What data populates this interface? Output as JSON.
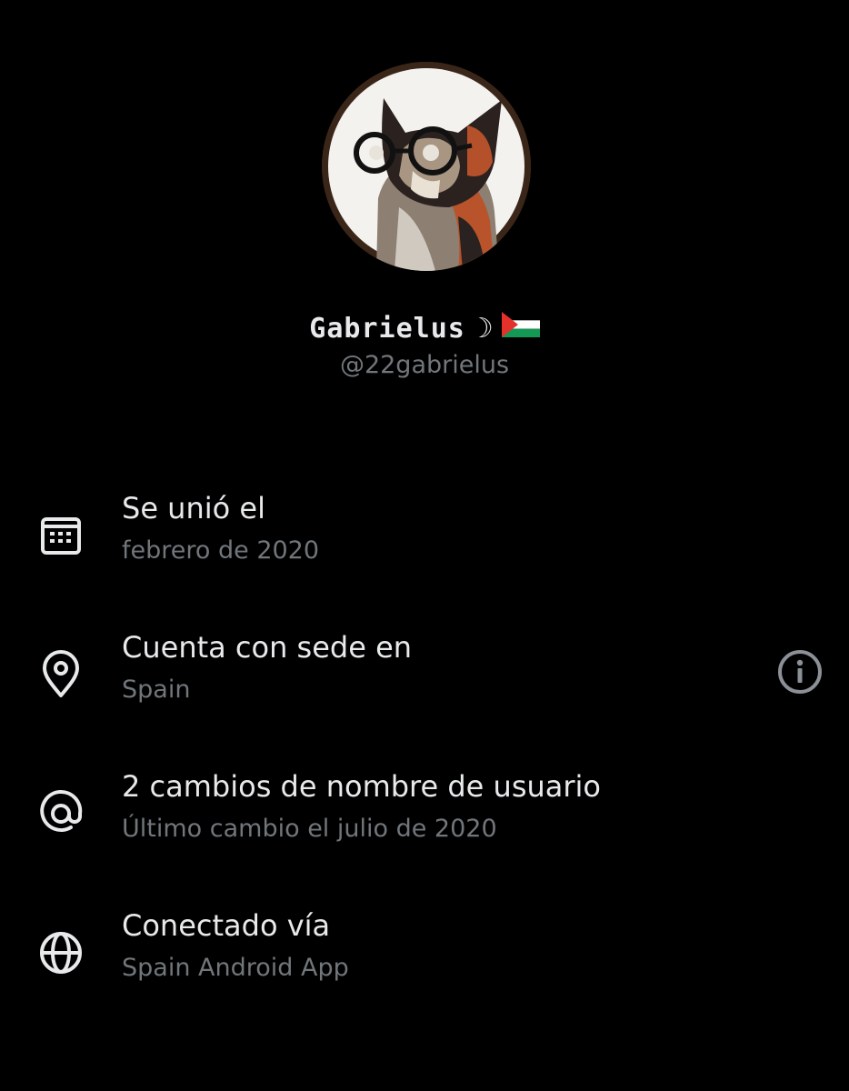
{
  "profile": {
    "display_name": "Gabrielus",
    "name_suffix": "☽",
    "flag_icon": "palestine-flag-icon",
    "handle": "@22gabrielus",
    "avatar_icon": "cat-with-glasses-avatar"
  },
  "details": [
    {
      "icon": "calendar-icon",
      "title": "Se unió el",
      "subtitle": "febrero de 2020"
    },
    {
      "icon": "location-pin-icon",
      "title": "Cuenta con sede en",
      "subtitle": "Spain",
      "action_icon": "info-icon"
    },
    {
      "icon": "at-sign-icon",
      "title": "2 cambios de nombre de usuario",
      "subtitle": "Último cambio el julio de 2020"
    },
    {
      "icon": "globe-icon",
      "title": "Conectado vía",
      "subtitle": "Spain Android App"
    }
  ],
  "colors": {
    "background": "#000000",
    "primary_text": "#e7e9ea",
    "secondary_text": "#71767b"
  }
}
